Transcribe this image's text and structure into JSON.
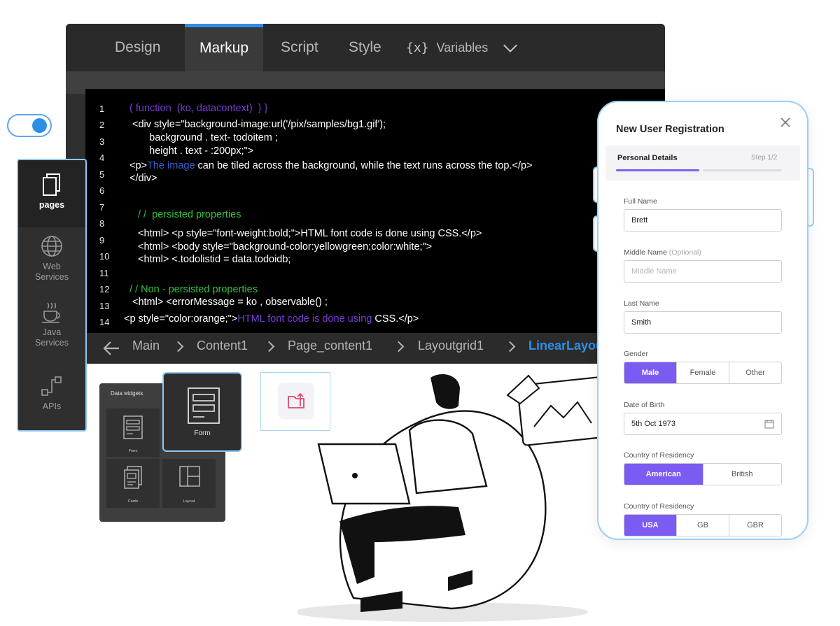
{
  "editor": {
    "tabs": [
      {
        "label": "Design"
      },
      {
        "label": "Markup"
      },
      {
        "label": "Script"
      },
      {
        "label": "Style"
      },
      {
        "label": "Variables",
        "icon": "{x}"
      }
    ],
    "active_tab": "Markup",
    "line_numbers": [
      "1",
      "2",
      "3",
      "4",
      "5",
      "6",
      "7",
      "8",
      "9",
      "10",
      "11",
      "12",
      "13",
      "14"
    ],
    "code": {
      "l1_open": "( ",
      "l1_func": "function  (ko, datacontext)",
      "l1_close": "  } }",
      "l2": "<div style=\"background-image:url('/pix/samples/bg1.gif');",
      "l3": "      background . text- todoitem ;",
      "l4": "      height . text - :200px;\">",
      "l5_open": "<p>",
      "l5_blue": "The image",
      "l5_rest": " can be tiled across the background, while the text runs across the top.</p>",
      "l6": "</div>",
      "l8": "/ /  persisted properties",
      "l9": "<html> <p style=\"font-weight:bold;\">HTML font code is done using CSS.</p>",
      "l10": "<html> <body style=\"background-color:yellowgreen;color:white;\">",
      "l11": "<html> <.todolistid = data.todoidb;",
      "l13": "/ / Non - persisted properties",
      "l14": "<html> <errorMessage = ko , observable() ;",
      "l15_open": "<p style=\"color:orange;\">",
      "l15_purple": "HTML font code is done using",
      "l15_rest": " CSS.</p>"
    },
    "breadcrumb": [
      "Main",
      "Content1",
      "Page_content1",
      "Layoutgrid1",
      "LinearLayou"
    ]
  },
  "toggle": {
    "state": "on",
    "color": "#2d8fe6"
  },
  "sidebar": {
    "items": [
      {
        "label": "pages",
        "icon": "pages-icon"
      },
      {
        "label": "Web\nServices",
        "icon": "globe-icon"
      },
      {
        "label": "Java\nServices",
        "icon": "coffee-icon"
      },
      {
        "label": "APIs",
        "icon": "api-icon"
      }
    ]
  },
  "widgets": {
    "title": "Data widgets",
    "items": [
      {
        "label": "Form",
        "icon": "form-icon"
      },
      {
        "label": "Cards",
        "icon": "cards-icon"
      },
      {
        "label": "Layout",
        "icon": "layout-icon"
      }
    ],
    "form_card_label": "Form"
  },
  "registration": {
    "title": "New User Registration",
    "step_label": "Personal Details",
    "step_count": "Step 1/2",
    "fields": {
      "full_name_label": "Full Name",
      "full_name_value": "Brett",
      "middle_name_label": "Middle Name",
      "middle_name_optional": "(Optional)",
      "middle_name_placeholder": "Middle Name",
      "last_name_label": "Last Name",
      "last_name_value": "Smith",
      "gender_label": "Gender",
      "gender_options": [
        "Male",
        "Female",
        "Other"
      ],
      "gender_selected": "Male",
      "dob_label": "Date of Birth",
      "dob_value": "5th Oct 1973",
      "residency1_label": "Country of Residency",
      "residency1_options": [
        "American",
        "British"
      ],
      "residency1_selected": "American",
      "residency2_label": "Country of Residency",
      "residency2_options": [
        "USA",
        "GB",
        "GBR"
      ],
      "residency2_selected": "USA"
    },
    "accent": "#7b5bf2"
  }
}
